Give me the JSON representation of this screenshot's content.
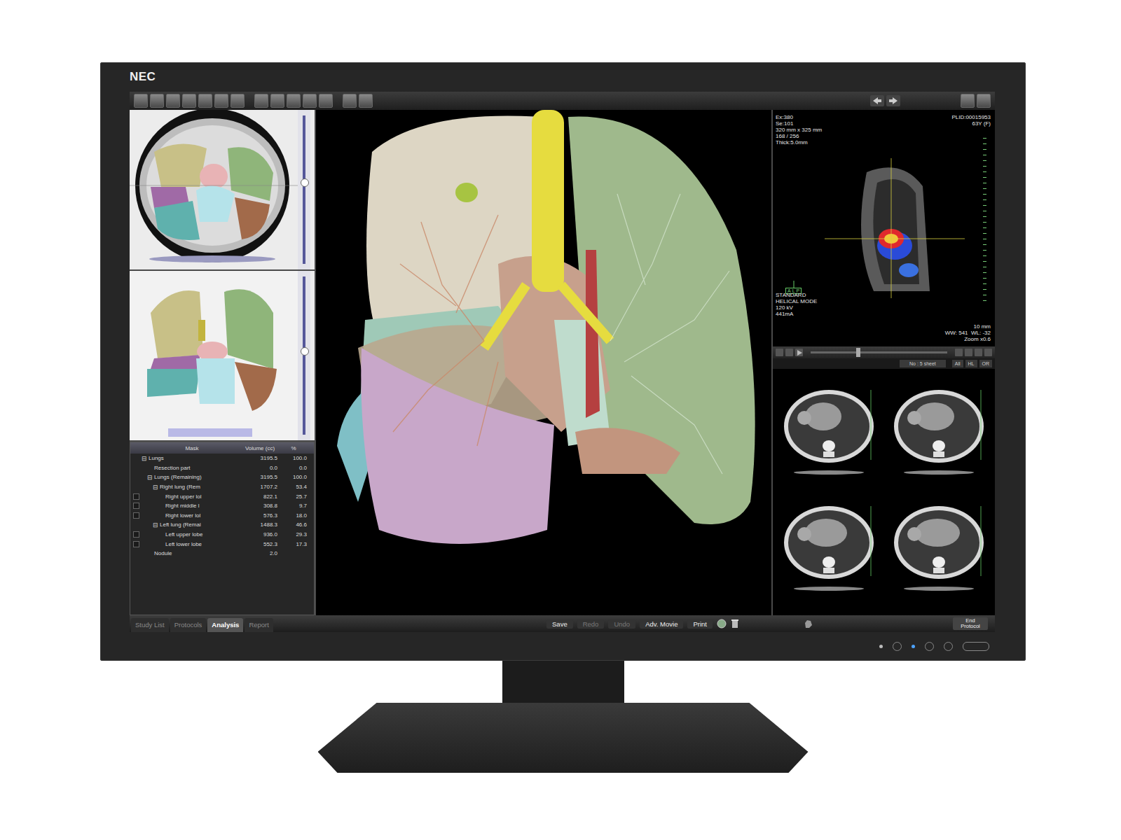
{
  "brand": "NEC",
  "axial_view": {
    "slider_level": 0.45
  },
  "coronal_view": {
    "slider_level": 0.47
  },
  "volume_table": {
    "columns": [
      "Mask",
      "Volume (cc)",
      "%"
    ],
    "rows": [
      {
        "kind": "group",
        "toggle": "⊟",
        "name": "Lungs",
        "volume": "3195.5",
        "percent": "100.0",
        "depth": 0
      },
      {
        "kind": "plain",
        "name": "Resection part",
        "volume": "0.0",
        "percent": "0.0",
        "depth": 1
      },
      {
        "kind": "group",
        "toggle": "⊟",
        "name": "Lungs (Remaining)",
        "volume": "3195.5",
        "percent": "100.0",
        "depth": 1
      },
      {
        "kind": "group",
        "toggle": "⊟",
        "name": "Right lung (Rem",
        "volume": "1707.2",
        "percent": "53.4",
        "depth": 2
      },
      {
        "kind": "check",
        "checked": false,
        "name": "Right upper lol",
        "volume": "822.1",
        "percent": "25.7",
        "depth": 3
      },
      {
        "kind": "check",
        "checked": false,
        "name": "Right middle l",
        "volume": "308.8",
        "percent": "9.7",
        "depth": 3
      },
      {
        "kind": "check",
        "checked": false,
        "name": "Right lower lol",
        "volume": "576.3",
        "percent": "18.0",
        "depth": 3
      },
      {
        "kind": "group",
        "toggle": "⊟",
        "name": "Left lung (Remai",
        "volume": "1488.3",
        "percent": "46.6",
        "depth": 2
      },
      {
        "kind": "check",
        "checked": false,
        "name": "Left upper lobe",
        "volume": "936.0",
        "percent": "29.3",
        "depth": 3
      },
      {
        "kind": "check",
        "checked": false,
        "name": "Left lower lobe",
        "volume": "552.3",
        "percent": "17.3",
        "depth": 3
      },
      {
        "kind": "plain",
        "name": "Nodule",
        "volume": "2.0",
        "depth": 1
      }
    ]
  },
  "viewer": {
    "top_left": [
      "Ex:380",
      "Se:101",
      "320 mm x 325 mm",
      "168 / 256",
      "Thick:5.0mm"
    ],
    "top_right": [
      "PLID:00015953",
      "63Y (F)"
    ],
    "bottom_left": [
      "STANDARD",
      "HELICAL MODE",
      "120 kV",
      "441mA"
    ],
    "bottom_right": [
      "WW: 541  WL: -32",
      "Zoom x0.6"
    ],
    "scale": "10 mm",
    "orientation": [
      "A",
      "L",
      "P"
    ]
  },
  "series_strip": {
    "cine_level": 0.35,
    "label": "No : 5 sheet",
    "buttons": [
      "All",
      "HL",
      "OR"
    ]
  },
  "tabs": [
    {
      "label": "Study List",
      "selected": false
    },
    {
      "label": "Protocols",
      "selected": false
    },
    {
      "label": "Analysis",
      "selected": true
    },
    {
      "label": "Report",
      "selected": false
    }
  ],
  "actions": [
    {
      "label": "Save",
      "disabled": false
    },
    {
      "label": "Redo",
      "disabled": true
    },
    {
      "label": "Undo",
      "disabled": true
    },
    {
      "label": "Adv. Movie",
      "disabled": false
    },
    {
      "label": "Print",
      "disabled": false
    }
  ],
  "end_button": "End Protocol"
}
